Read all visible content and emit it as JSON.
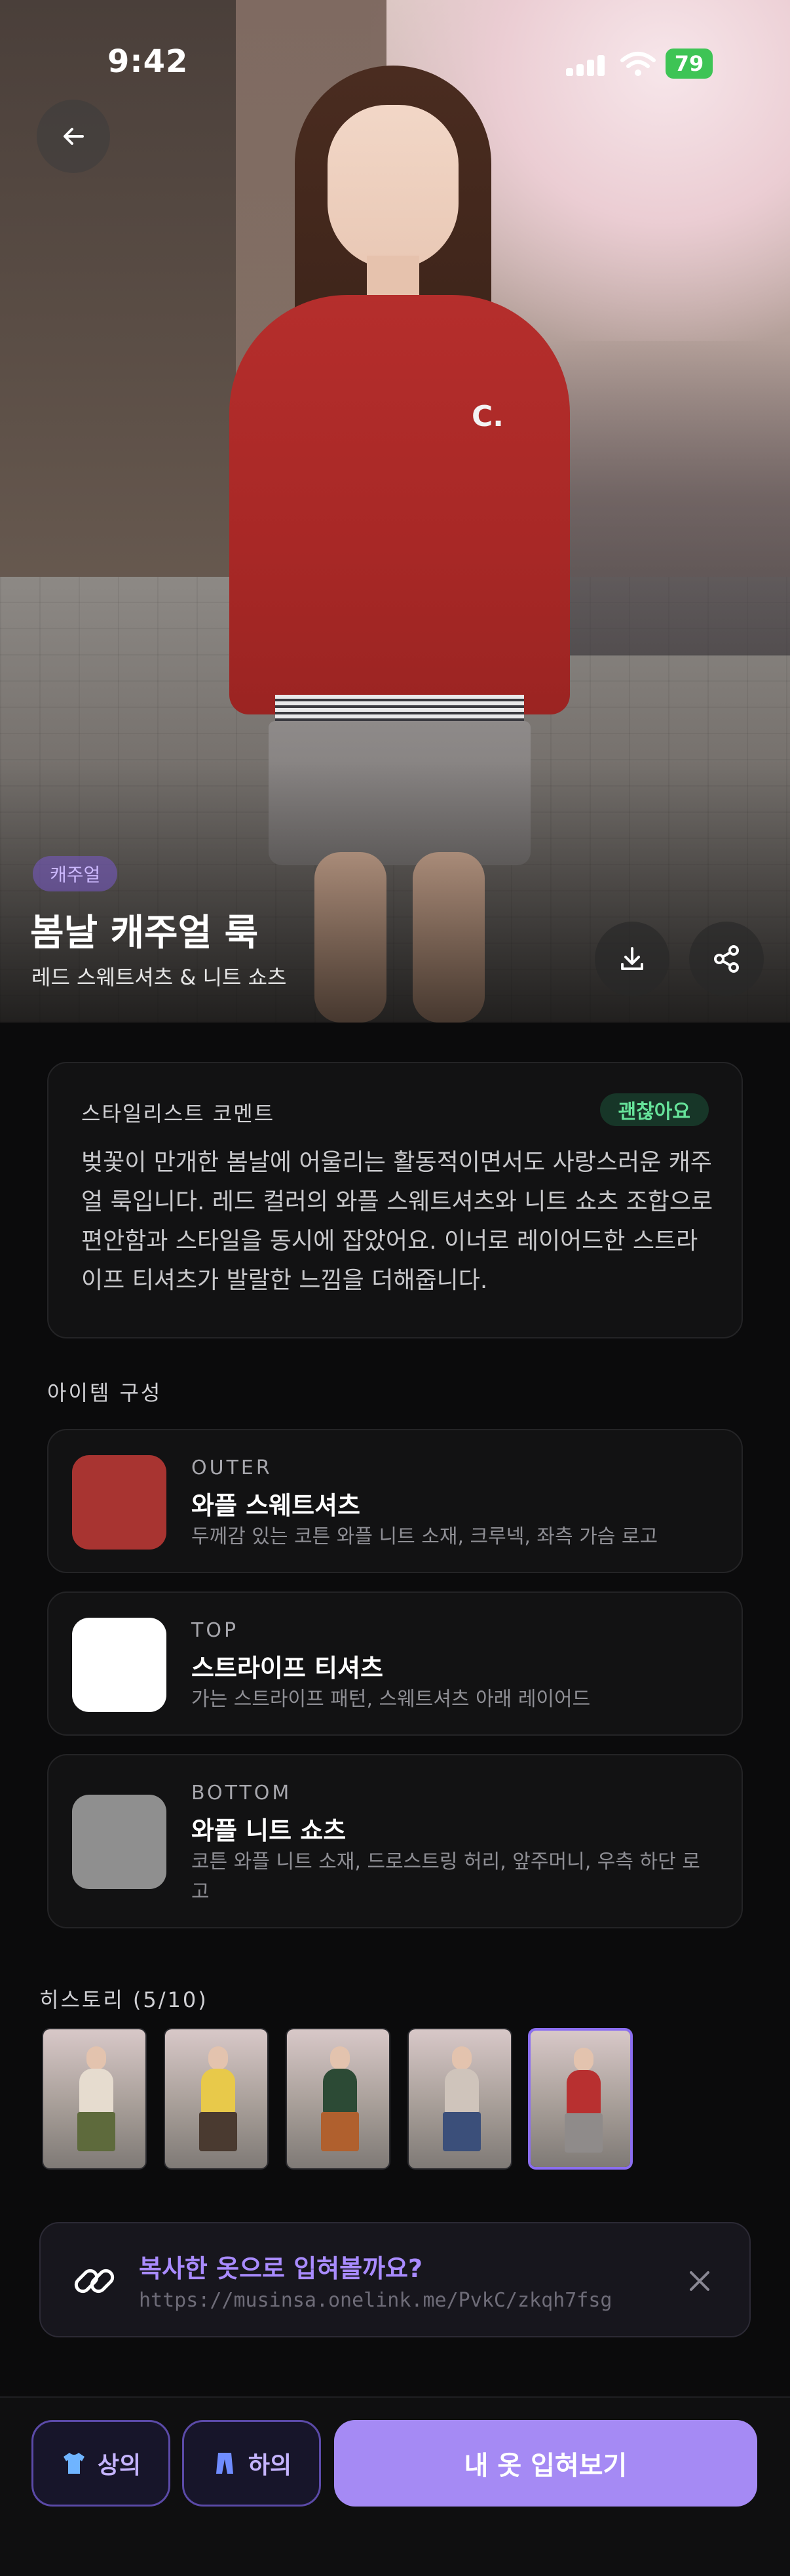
{
  "status_bar": {
    "time": "9:42",
    "battery": "79"
  },
  "hero": {
    "tag": "캐주얼",
    "title": "봄날 캐주얼 룩",
    "subtitle": "레드 스웨트셔츠 & 니트 쇼츠"
  },
  "comment": {
    "label": "스타일리스트 코멘트",
    "badge": "괜찮아요",
    "text": "벚꽃이 만개한 봄날에 어울리는 활동적이면서도 사랑스러운 캐주얼 룩입니다. 레드 컬러의 와플 스웨트셔츠와 니트 쇼츠 조합으로 편안함과 스타일을 동시에 잡았어요. 이너로 레이어드한 스트라이프 티셔츠가 발랄한 느낌을 더해줍니다."
  },
  "items_section": {
    "label": "아이템 구성",
    "items": [
      {
        "category": "OUTER",
        "name": "와플 스웨트셔츠",
        "description": "두께감 있는 코튼 와플 니트 소재, 크루넥, 좌측 가슴 로고",
        "color": "#a83431"
      },
      {
        "category": "TOP",
        "name": "스트라이프 티셔츠",
        "description": "가는 스트라이프 패턴, 스웨트셔츠 아래 레이어드",
        "color": "#ffffff"
      },
      {
        "category": "BOTTOM",
        "name": "와플 니트 쇼츠",
        "description": "코튼 와플 니트 소재, 드로스트링 허리, 앞주머니, 우측 하단 로고",
        "color": "#8f8f8f"
      }
    ]
  },
  "history": {
    "label": "히스토리 (5/10)",
    "thumbs": [
      {
        "top": "#e6dccf",
        "bottom": "#5e6a3c"
      },
      {
        "top": "#e8c94a",
        "bottom": "#4a3a30"
      },
      {
        "top": "#2c4a35",
        "bottom": "#b0602e"
      },
      {
        "top": "#cfc4bb",
        "bottom": "#3b4f7a"
      },
      {
        "top": "#b83030",
        "bottom": "#8f8b8a"
      }
    ],
    "active_index": 4
  },
  "link_prompt": {
    "title": "복사한 옷으로 입혀볼까요?",
    "url": "https://musinsa.onelink.me/PvkC/zkqh7fsg"
  },
  "bottom_bar": {
    "top_label": "상의",
    "bottom_label": "하의",
    "primary_label": "내 옷 입혀보기"
  },
  "icons": [
    "arrow-left-icon",
    "download-icon",
    "share-icon",
    "link-icon",
    "close-icon",
    "shirt-icon",
    "pants-icon"
  ],
  "colors": {
    "accent": "#a58af4",
    "ok_green": "#66e39a",
    "background": "#0b0b0c"
  }
}
